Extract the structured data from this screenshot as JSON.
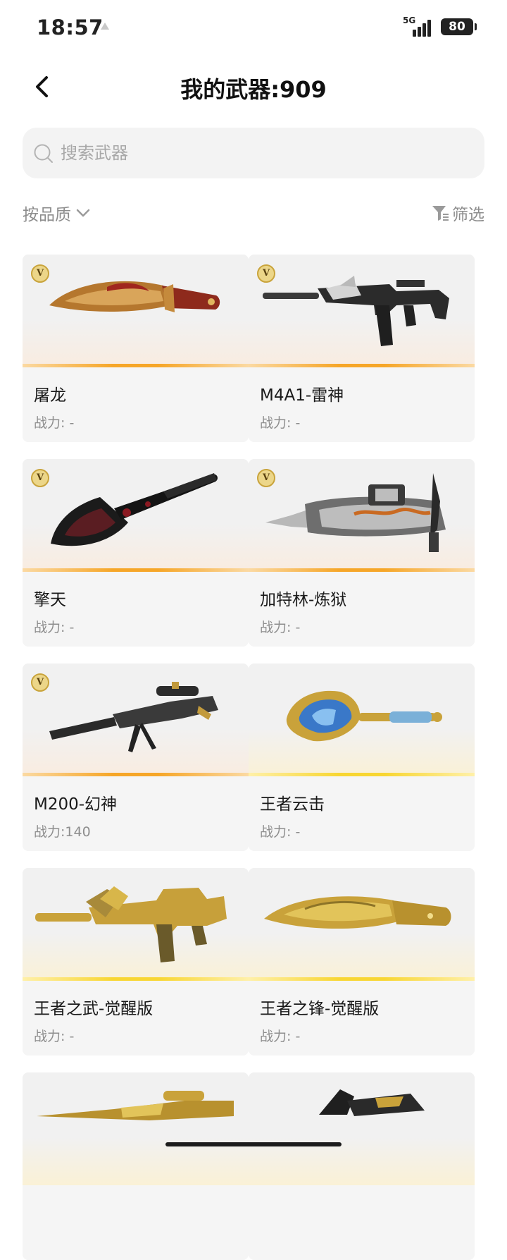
{
  "status_bar": {
    "time": "18:57",
    "network": "5G",
    "battery": "80"
  },
  "header": {
    "title": "我的武器:909"
  },
  "search": {
    "placeholder": "搜索武器"
  },
  "toolbar": {
    "sort_label": "按品质",
    "filter_label": "筛选"
  },
  "badge_text": "V",
  "colors": {
    "orange_accent": "#f6a628",
    "gold_accent": "#f8d632",
    "text_secondary": "#8e8e8e"
  },
  "weapons": [
    {
      "name": "屠龙",
      "power": "战力: -",
      "vip": true,
      "tier": "orange",
      "icon": "dragon-knife-icon"
    },
    {
      "name": "M4A1-雷神",
      "power": "战力: -",
      "vip": true,
      "tier": "orange",
      "icon": "assault-rifle-icon"
    },
    {
      "name": "擎天",
      "power": "战力: -",
      "vip": true,
      "tier": "orange",
      "icon": "shovel-icon"
    },
    {
      "name": "加特林-炼狱",
      "power": "战力: -",
      "vip": true,
      "tier": "orange",
      "icon": "gatling-gun-icon"
    },
    {
      "name": "M200-幻神",
      "power": "战力:140",
      "vip": true,
      "tier": "orange",
      "icon": "sniper-rifle-icon"
    },
    {
      "name": "王者云击",
      "power": "战力: -",
      "vip": false,
      "tier": "gold",
      "icon": "blue-shovel-icon"
    },
    {
      "name": "王者之武-觉醒版",
      "power": "战力: -",
      "vip": false,
      "tier": "gold",
      "icon": "gold-rifle-icon"
    },
    {
      "name": "王者之锋-觉醒版",
      "power": "战力: -",
      "vip": false,
      "tier": "gold",
      "icon": "gold-knife-icon"
    },
    {
      "name": "",
      "power": "",
      "vip": false,
      "tier": "none",
      "icon": "gold-sniper-icon"
    },
    {
      "name": "",
      "power": "",
      "vip": false,
      "tier": "none",
      "icon": "dark-weapon-icon"
    }
  ]
}
